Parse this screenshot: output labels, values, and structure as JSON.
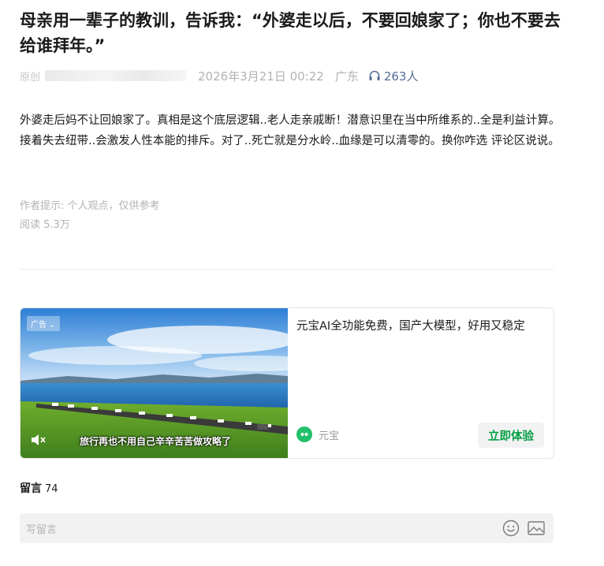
{
  "article": {
    "title": "母亲用一辈子的教训，告诉我：“外婆走以后，不要回娘家了；你也不要去给谁拜年。”",
    "origin_label": "原创",
    "date": "2026年3月21日 00:22",
    "region": "广东",
    "listen_count": "263人",
    "body": "外婆走后妈不让回娘家了。真相是这个底层逻辑..老人走亲戚断！潜意识里在当中所维系的..全是利益计算。接着失去纽带..会激发人性本能的排斥。对了..死亡就是分水岭..血缘是可以清零的。换你咋选 评论区说说。",
    "author_note": "作者提示: 个人观点，仅供参考",
    "read_count": "阅读 5.3万"
  },
  "ad": {
    "tag": "广告",
    "caption": "旅行再也不用自己辛辛苦苦做攻略了",
    "text": "元宝AI全功能免费，国产大模型，好用又稳定",
    "brand": "元宝",
    "cta": "立即体验",
    "cta_color": "#07a046",
    "brand_color": "#22c06a"
  },
  "comments": {
    "label": "留言",
    "count": "74",
    "placeholder": "写留言",
    "icons": [
      "emoji-icon",
      "image-icon"
    ]
  },
  "colors": {
    "meta_gray": "#b2b2b2",
    "link_blue": "#576b95",
    "input_bg": "#f2f2f2"
  }
}
